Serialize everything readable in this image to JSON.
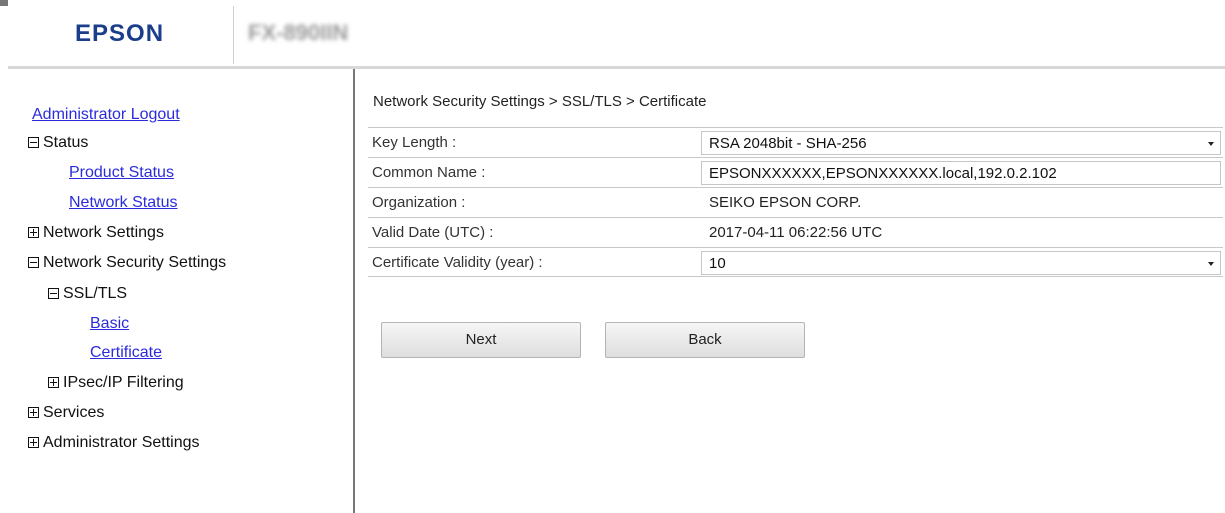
{
  "header": {
    "brand": "EPSON",
    "model": "FX-890IIN"
  },
  "sidebar": {
    "logout": "Administrator Logout",
    "items": [
      {
        "label": "Status",
        "type": "group",
        "expanded": true
      },
      {
        "label": "Product Status",
        "type": "link"
      },
      {
        "label": "Network Status",
        "type": "link"
      },
      {
        "label": "Network Settings",
        "type": "group",
        "expanded": false
      },
      {
        "label": "Network Security Settings",
        "type": "group",
        "expanded": true
      },
      {
        "label": "SSL/TLS",
        "type": "group",
        "expanded": true
      },
      {
        "label": "Basic",
        "type": "link"
      },
      {
        "label": "Certificate",
        "type": "link"
      },
      {
        "label": "IPsec/IP Filtering",
        "type": "group",
        "expanded": false
      },
      {
        "label": "Services",
        "type": "group",
        "expanded": false
      },
      {
        "label": "Administrator Settings",
        "type": "group",
        "expanded": false
      }
    ]
  },
  "main": {
    "breadcrumb": "Network Security Settings > SSL/TLS > Certificate",
    "rows": [
      {
        "label": "Key Length :",
        "value": "RSA 2048bit - SHA-256",
        "control": "select"
      },
      {
        "label": "Common Name :",
        "value": "EPSONXXXXXX,EPSONXXXXXX.local,192.0.2.102",
        "control": "input"
      },
      {
        "label": "Organization :",
        "value": "SEIKO EPSON CORP.",
        "control": "text"
      },
      {
        "label": "Valid Date (UTC) :",
        "value": "2017-04-11 06:22:56 UTC",
        "control": "text"
      },
      {
        "label": "Certificate Validity (year) :",
        "value": "10",
        "control": "select"
      }
    ],
    "buttons": {
      "next": "Next",
      "back": "Back"
    }
  },
  "colors": {
    "brand": "#1a3e8a",
    "link": "#2b2bdc",
    "divider": "#777777"
  },
  "icons": {
    "expanded": "minus-box-icon",
    "collapsed": "plus-box-icon",
    "dropdown": "chevron-down-icon"
  }
}
